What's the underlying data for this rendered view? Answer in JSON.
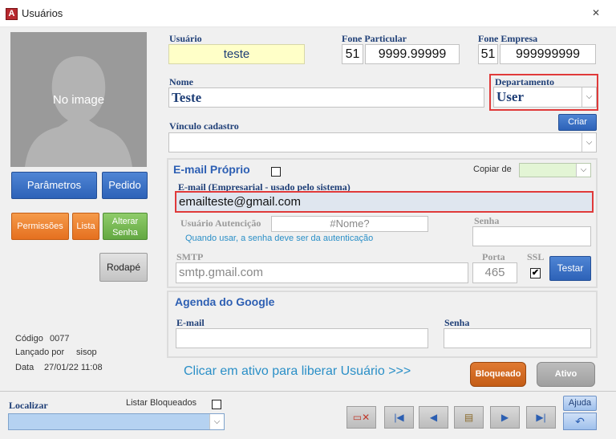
{
  "window": {
    "title": "Usuários",
    "app_icon_letter": "A"
  },
  "photo": {
    "placeholder": "No image"
  },
  "left_buttons": {
    "parametros": "Parâmetros",
    "pedido": "Pedido",
    "permissoes": "Permissões",
    "lista": "Lista",
    "alterar_senha_1": "Alterar",
    "alterar_senha_2": "Senha",
    "rodape": "Rodapé"
  },
  "meta": {
    "codigo_label": "Código",
    "codigo_value": "0077",
    "lancado_label": "Lançado por",
    "lancado_value": "sisop",
    "data_label": "Data",
    "data_value": "27/01/22 11:08"
  },
  "header": {
    "usuario_label": "Usuário",
    "usuario_value": "teste",
    "fone_part_label": "Fone Particular",
    "fone_part_ddd": "51",
    "fone_part_num": "9999.99999",
    "fone_emp_label": "Fone Empresa",
    "fone_emp_ddd": "51",
    "fone_emp_num": "999999999",
    "nome_label": "Nome",
    "nome_value": "Teste",
    "depto_label": "Departamento",
    "depto_value": "User",
    "vinculo_label": "Vínculo cadastro",
    "vinculo_value": "",
    "criar_button": "Criar"
  },
  "email_section": {
    "title": "E-mail Próprio",
    "copiar_label": "Copiar de",
    "email_label": "E-mail (Empresarial - usado pelo sistema)",
    "email_value": "emailteste@gmail.com",
    "usuario_auth_label": "Usuário Autencição",
    "usuario_auth_value": "#Nome?",
    "senha_label": "Senha",
    "hint": "Quando usar, a senha deve ser da autenticação",
    "smtp_label": "SMTP",
    "smtp_value": "smtp.gmail.com",
    "porta_label": "Porta",
    "porta_value": "465",
    "ssl_label": "SSL",
    "testar_button": "Testar"
  },
  "google_section": {
    "title": "Agenda do Google",
    "email_label": "E-mail",
    "senha_label": "Senha"
  },
  "status": {
    "hint": "Clicar em ativo para liberar Usuário >>>",
    "bloqueado": "Bloqueado",
    "ativo": "Ativo"
  },
  "bottom": {
    "localizar_label": "Localizar",
    "listar_bloqueados_label": "Listar Bloqueados",
    "ajuda_button": "Ajuda"
  },
  "colors": {
    "accent": "#2d62b8",
    "highlight": "#e03a3a",
    "hint": "#2a8fc7"
  }
}
